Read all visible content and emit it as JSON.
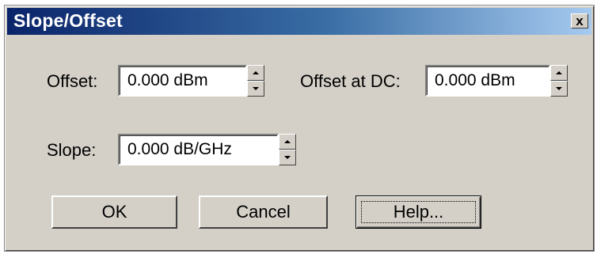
{
  "window": {
    "title": "Slope/Offset",
    "close_label": "x"
  },
  "fields": {
    "offset": {
      "label": "Offset:",
      "value": "0.000 dBm"
    },
    "offset_dc": {
      "label": "Offset at DC:",
      "value": "0.000 dBm"
    },
    "slope": {
      "label": "Slope:",
      "value": "0.000 dB/GHz"
    }
  },
  "buttons": {
    "ok": "OK",
    "cancel": "Cancel",
    "help": "Help..."
  },
  "colors": {
    "dialog_bg": "#d4d0c8",
    "titlebar_start": "#0a246a",
    "titlebar_end": "#a6caf0"
  },
  "icons": {
    "close": "close-icon",
    "spin_up": "spin-up-icon",
    "spin_down": "spin-down-icon"
  }
}
